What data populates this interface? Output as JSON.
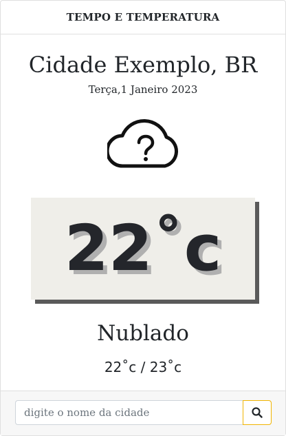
{
  "header": {
    "title": "TEMPO E TEMPERATURA"
  },
  "location": {
    "city": "Cidade Exemplo, BR",
    "date": "Terça,1 Janeiro 2023"
  },
  "weather": {
    "icon": "cloud-question-icon",
    "temperature": "22˚c",
    "condition": "Nublado",
    "min_max": "22˚c / 23˚c"
  },
  "search": {
    "placeholder": "digite o nome da cidade",
    "value": "",
    "button_icon": "search-icon"
  },
  "colors": {
    "temp_box_bg": "#efeee9",
    "temp_box_shadow": "#5a5a5a",
    "search_button_border": "#f0b400"
  }
}
